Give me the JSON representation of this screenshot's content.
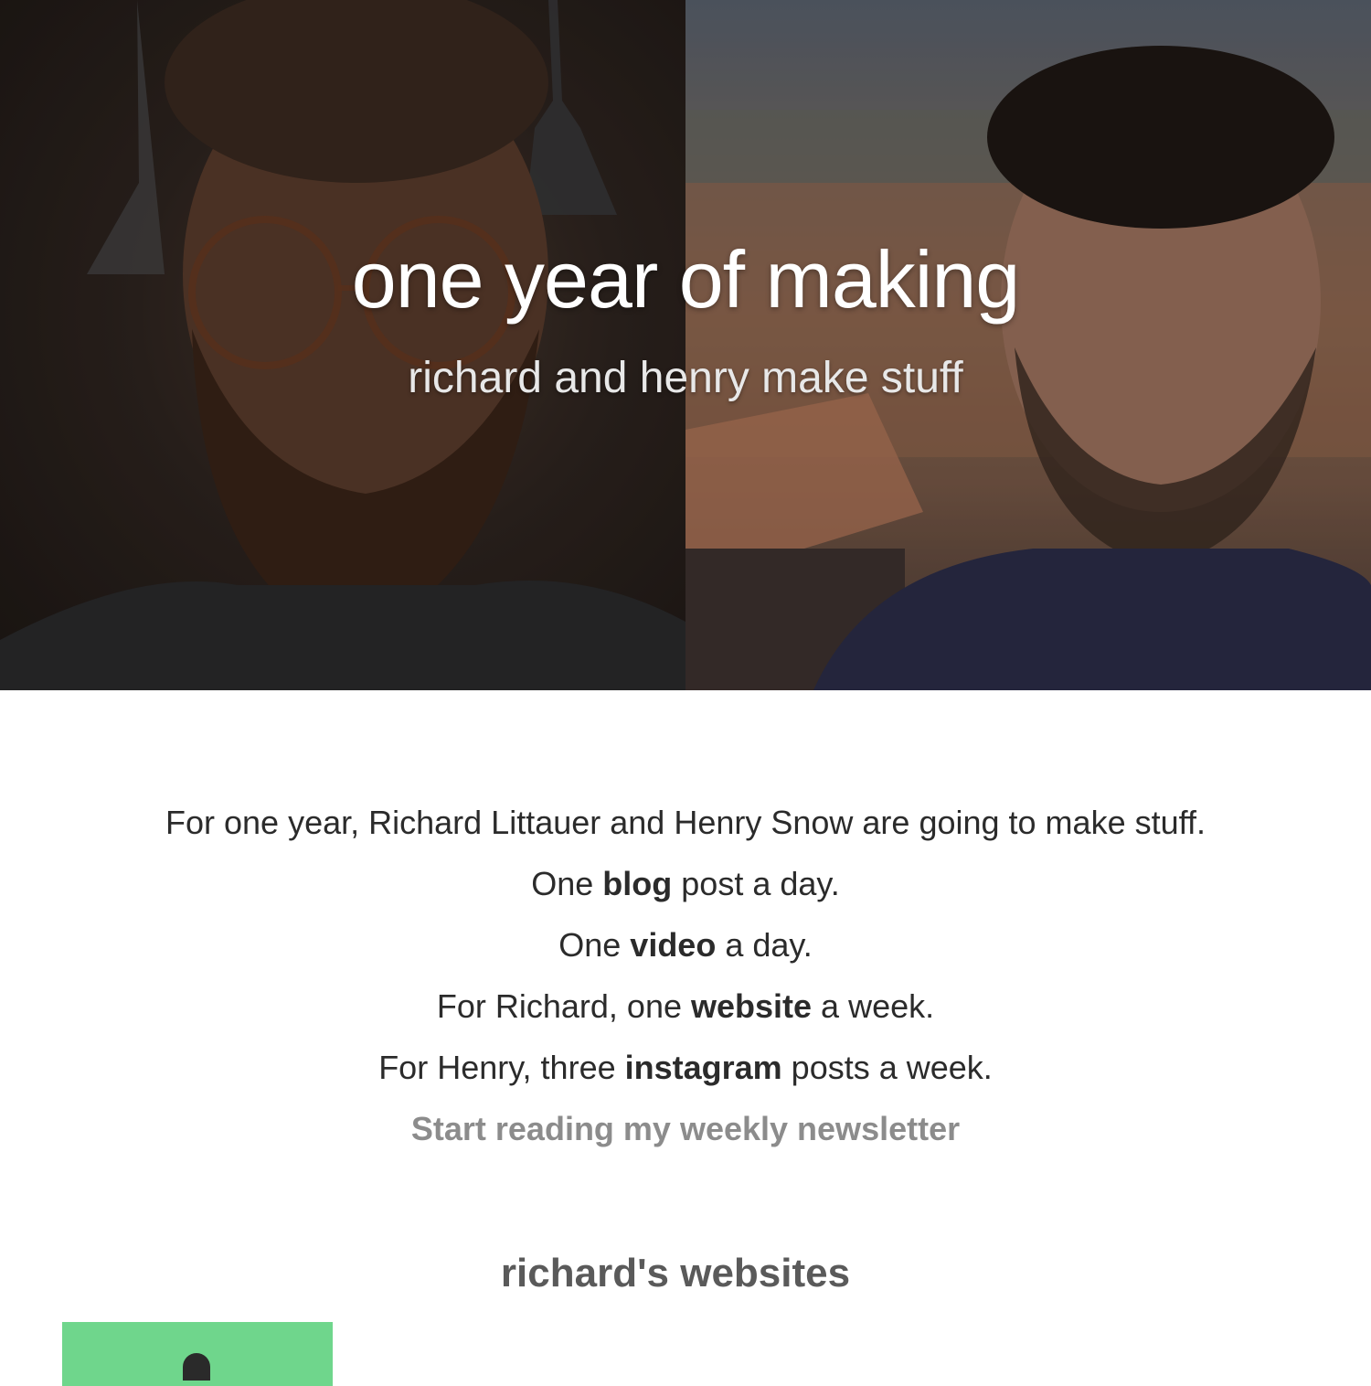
{
  "hero": {
    "title": "one year of making",
    "subtitle": "richard and henry make stuff"
  },
  "intro": {
    "line1": "For one year, Richard Littauer and Henry Snow are going to make stuff.",
    "line2": {
      "pre": "One ",
      "bold": "blog",
      "post": " post a day."
    },
    "line3": {
      "pre": "One ",
      "bold": "video",
      "post": " a day."
    },
    "line4": {
      "pre": "For Richard, one ",
      "bold": "website",
      "post": " a week."
    },
    "line5": {
      "pre": "For Henry, three ",
      "bold": "instagram",
      "post": " posts a week."
    },
    "newsletter_link": "Start reading my weekly newsletter"
  },
  "websites": {
    "heading": "richard's websites"
  },
  "colors": {
    "thumb_green": "#6fd68c",
    "link_gray": "#8c8c8c",
    "heading_gray": "#5a5a5a"
  }
}
